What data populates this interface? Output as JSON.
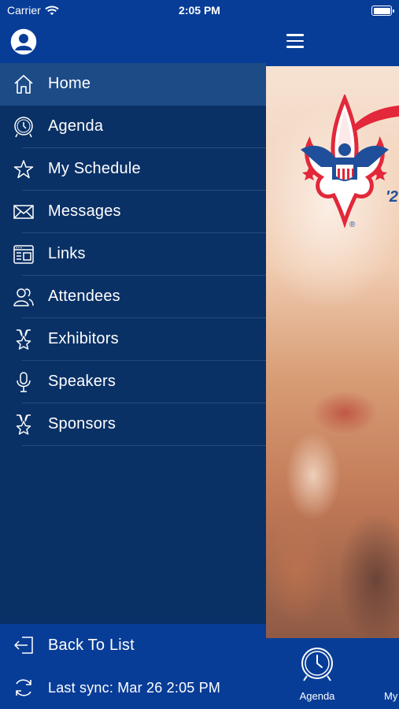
{
  "status_bar": {
    "carrier": "Carrier",
    "time": "2:05 PM"
  },
  "drawer": {
    "avatar_icon": "user-circle-icon",
    "menu": [
      {
        "label": "Home",
        "icon": "home-icon",
        "active": true
      },
      {
        "label": "Agenda",
        "icon": "clock-icon",
        "active": false
      },
      {
        "label": "My Schedule",
        "icon": "star-icon",
        "active": false
      },
      {
        "label": "Messages",
        "icon": "envelope-icon",
        "active": false
      },
      {
        "label": "Links",
        "icon": "links-icon",
        "active": false
      },
      {
        "label": "Attendees",
        "icon": "people-icon",
        "active": false
      },
      {
        "label": "Exhibitors",
        "icon": "award-icon",
        "active": false
      },
      {
        "label": "Speakers",
        "icon": "microphone-icon",
        "active": false
      },
      {
        "label": "Sponsors",
        "icon": "award-icon",
        "active": false
      }
    ],
    "back_label": "Back To List",
    "sync_label": "Last sync:  Mar 26 2:05 PM"
  },
  "main": {
    "logo_fragment": "'2",
    "tabs": [
      {
        "label": "Agenda",
        "icon": "clock-icon"
      },
      {
        "label": "My",
        "icon": "star-icon"
      }
    ]
  },
  "colors": {
    "drawer_bg": "#0a3166",
    "header_bg": "#083d97",
    "active_row": "#1d4b86",
    "logo_red": "#e2283a",
    "logo_blue": "#1f4f9a"
  }
}
